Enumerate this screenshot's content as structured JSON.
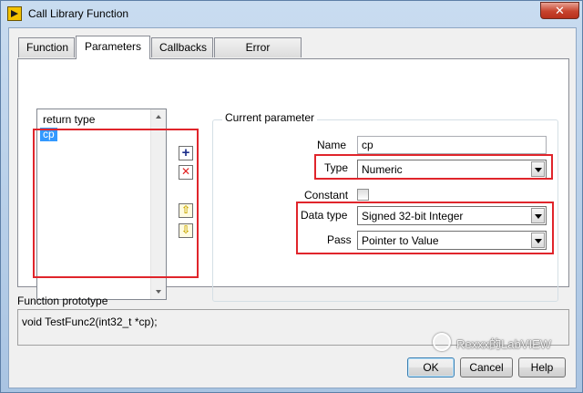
{
  "window": {
    "title": "Call Library Function",
    "close_glyph": "✕"
  },
  "tabs": [
    {
      "label": "Function"
    },
    {
      "label": "Parameters"
    },
    {
      "label": "Callbacks"
    },
    {
      "label": "Error Checking"
    }
  ],
  "param_list": {
    "items": [
      {
        "label": "return type"
      },
      {
        "label": "cp",
        "selected": true
      }
    ]
  },
  "tools": {
    "add_glyph": "+",
    "delete_glyph": "✕",
    "up_glyph": "⇧",
    "down_glyph": "⇩"
  },
  "current_parameter": {
    "group_title": "Current parameter",
    "name_label": "Name",
    "name_value": "cp",
    "type_label": "Type",
    "type_value": "Numeric",
    "constant_label": "Constant",
    "data_type_label": "Data type",
    "data_type_value": "Signed 32-bit Integer",
    "pass_label": "Pass",
    "pass_value": "Pointer to Value"
  },
  "prototype": {
    "label": "Function prototype",
    "text": "void  TestFunc2(int32_t *cp);"
  },
  "buttons": {
    "ok_label": "OK",
    "cancel_label": "Cancel",
    "help_label": "Help"
  },
  "watermark": {
    "text": "Rexxx的LabVIEW"
  },
  "colors": {
    "highlight": "#e0252b",
    "selection": "#3399ff"
  }
}
